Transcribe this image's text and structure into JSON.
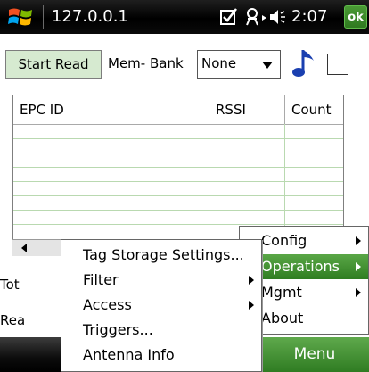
{
  "titlebar": {
    "address": "127.0.0.1",
    "time": "2:07",
    "ok_label": "ok"
  },
  "controls": {
    "start_read_label": "Start Read",
    "mem_bank_label": "Mem- Bank",
    "mem_bank_selected": "None"
  },
  "table": {
    "columns": [
      "EPC ID",
      "RSSI",
      "Count"
    ]
  },
  "background_labels": {
    "tot": "Tot",
    "rea": "Rea"
  },
  "menubar": {
    "menu_label": "Menu"
  },
  "main_menu": {
    "items": [
      {
        "label": "Config",
        "has_submenu": true
      },
      {
        "label": "Operations",
        "has_submenu": true,
        "highlighted": true
      },
      {
        "label": "Mgmt",
        "has_submenu": true
      },
      {
        "label": "About",
        "has_submenu": false
      }
    ]
  },
  "operations_submenu": {
    "items": [
      {
        "label": "Tag Storage Settings...",
        "has_submenu": false
      },
      {
        "label": "Filter",
        "has_submenu": true
      },
      {
        "label": "Access",
        "has_submenu": true
      },
      {
        "label": "Triggers...",
        "has_submenu": false
      },
      {
        "label": "Antenna Info",
        "has_submenu": false
      }
    ]
  },
  "colors": {
    "accent_green": "#3f8f30",
    "title_bar": "#000000"
  }
}
